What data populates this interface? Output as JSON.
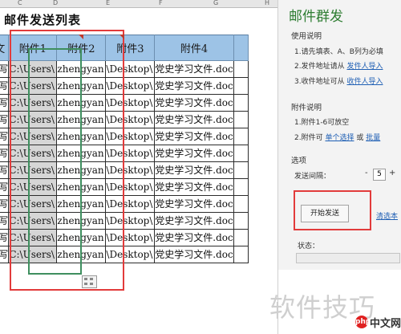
{
  "sheet": {
    "column_letters": [
      "C",
      "D",
      "E",
      "F",
      "G",
      "H"
    ],
    "title": "邮件发送列表",
    "headers": [
      "正文",
      "附件1",
      "附件2",
      "附件3",
      "附件4"
    ],
    "row_col1": "当时写",
    "row_col2": "C:\\Users\\",
    "row_col3": "zhengyan",
    "row_col4": "\\Desktop\\",
    "row_col5": "党史学习文件.doc",
    "row_count": 12
  },
  "pane": {
    "title": "邮件群发",
    "usage_heading": "使用说明",
    "usage_line1": "1.请先填表、A、B列为必填",
    "usage_line2_prefix": "2.发件地址请从",
    "usage_line2_link": "发件人导入",
    "usage_line3_prefix": "3.收件地址可从",
    "usage_line3_link": "收件人导入",
    "attach_heading": "附件说明",
    "attach_line1": "1.附件1-6可放空",
    "attach_line2_prefix": "2.附件可",
    "attach_line2_link1": "单个选择",
    "attach_line2_or": "或",
    "attach_line2_link2": "批量",
    "options_heading": "选项",
    "interval_label": "发送间隔：",
    "interval_value": "5",
    "minus": "-",
    "plus": "+",
    "start_button": "开始发送",
    "clear_link": "清选本",
    "status_label": "状态："
  },
  "watermark": "软件技巧",
  "logo": {
    "badge": "php",
    "text": "中文网"
  },
  "colors": {
    "header_bg": "#9dc3e6",
    "red_box": "#e23b3b",
    "green_box": "#3f8f5f",
    "pane_title": "#2e7d32",
    "link": "#1f5fb4"
  },
  "icons": {
    "paste_options": "paste-options-icon"
  }
}
